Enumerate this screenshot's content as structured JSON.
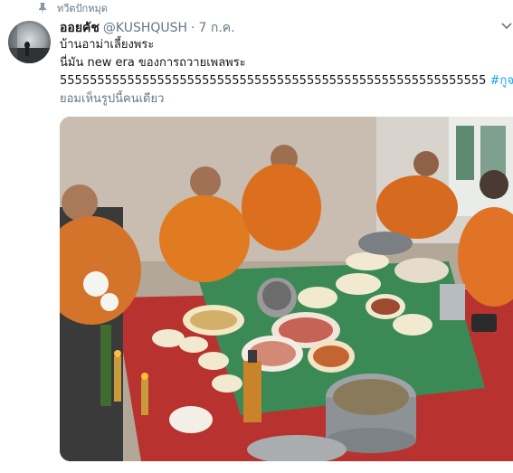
{
  "pinned": {
    "label": "ทวีตปักหมุด",
    "icon": "pin-icon"
  },
  "tweet": {
    "display_name": "ออยคัช",
    "handle": "@KUSHQUSH",
    "separator": "·",
    "timestamp": "7 ก.ค.",
    "text_lines": [
      "บ้านอาม่าเลี้ยงพระ",
      "นี่มัน new era ของการถวายเพลพระ",
      "555555555555555555555555555555555555555555555555555555555"
    ],
    "hashtag": "#กูจะไม่",
    "text_last_line": "ยอมเห็นรูปนี้คนเดียว",
    "caret_icon": "chevron-down-icon",
    "avatar": "avatar",
    "media": "photo-monks-meal"
  },
  "colors": {
    "accent": "#1da1f2",
    "secondary_text": "#657786",
    "primary_text": "#14171a"
  }
}
